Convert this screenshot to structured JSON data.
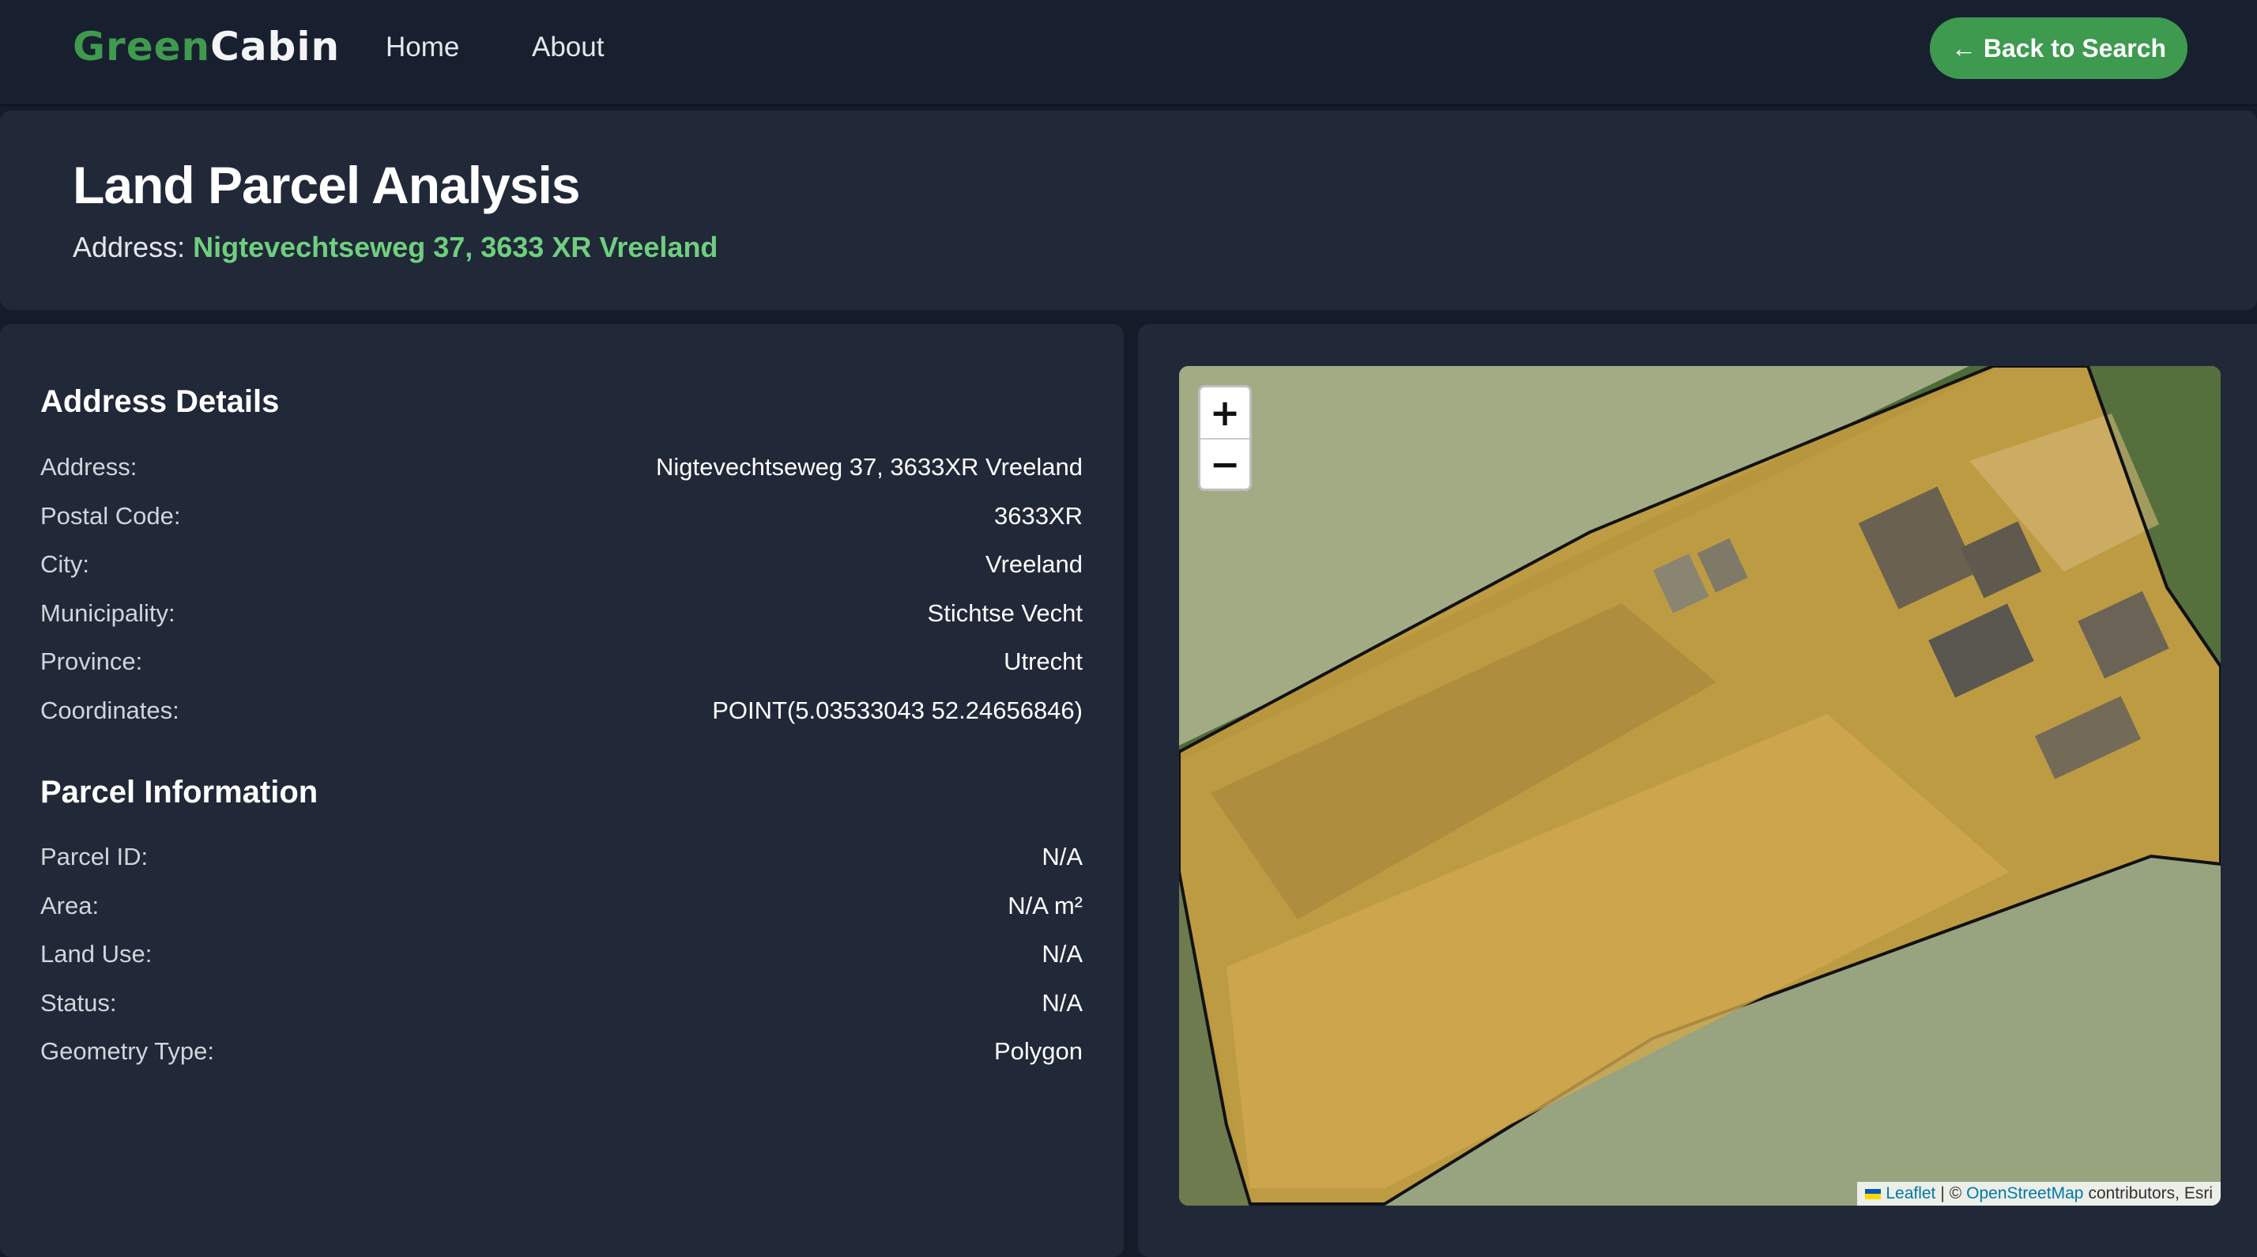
{
  "nav": {
    "logo_green": "Green",
    "logo_white": "Cabin",
    "links": [
      "Home",
      "About"
    ],
    "back_icon": "arrow-left-icon",
    "back_label": "← Back to Search"
  },
  "header": {
    "title": "Land Parcel Analysis",
    "address_label": "Address:",
    "address_value": "Nigtevechtseweg 37, 3633 XR Vreeland"
  },
  "address_details": {
    "title": "Address Details",
    "rows": [
      {
        "label": "Address:",
        "value": "Nigtevechtseweg 37, 3633XR Vreeland"
      },
      {
        "label": "Postal Code:",
        "value": "3633XR"
      },
      {
        "label": "City:",
        "value": "Vreeland"
      },
      {
        "label": "Municipality:",
        "value": "Stichtse Vecht"
      },
      {
        "label": "Province:",
        "value": "Utrecht"
      },
      {
        "label": "Coordinates:",
        "value": "POINT(5.03533043 52.24656846)"
      }
    ]
  },
  "parcel_info": {
    "title": "Parcel Information",
    "rows": [
      {
        "label": "Parcel ID:",
        "value": "N/A"
      },
      {
        "label": "Area:",
        "value": "N/A m²"
      },
      {
        "label": "Land Use:",
        "value": "N/A"
      },
      {
        "label": "Status:",
        "value": "N/A"
      },
      {
        "label": "Geometry Type:",
        "value": "Polygon"
      }
    ]
  },
  "map": {
    "zoom_in": "+",
    "zoom_out": "−",
    "attribution": {
      "leaflet": "Leaflet",
      "separator": "| ©",
      "osm": "OpenStreetMap",
      "rest": "contributors, Esri"
    }
  },
  "colors": {
    "brand_green": "#3d9a4f",
    "accent_text_green": "#6fcf7f",
    "panel_bg": "#212838",
    "page_bg": "#151c29"
  }
}
